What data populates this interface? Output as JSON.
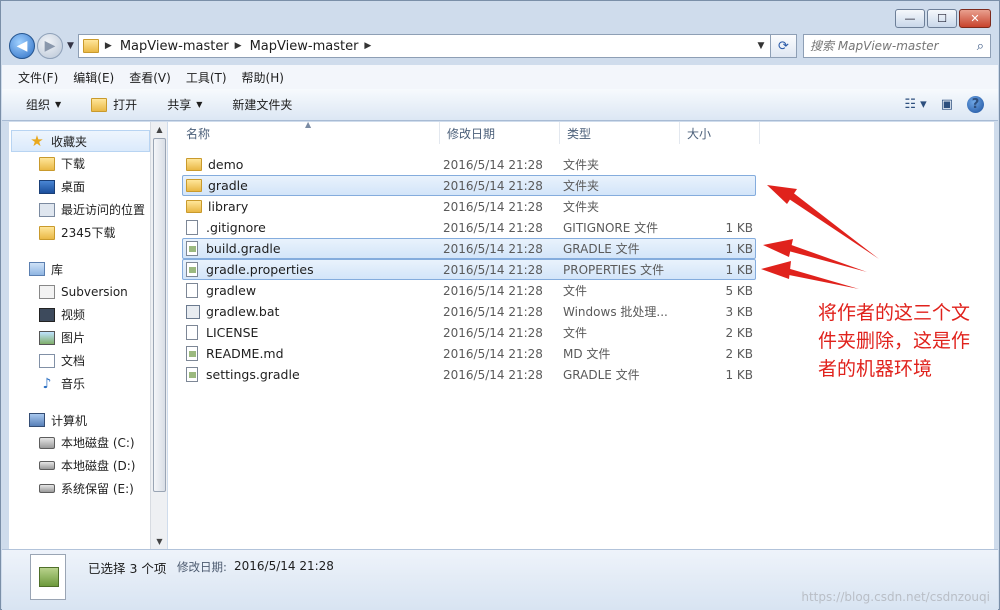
{
  "window": {
    "caption": {
      "minimize": "—",
      "maximize": "☐",
      "close": "✕"
    }
  },
  "address": {
    "crumbs": [
      "MapView-master",
      "MapView-master"
    ],
    "search_placeholder": "搜索 MapView-master"
  },
  "menu": [
    "文件(F)",
    "编辑(E)",
    "查看(V)",
    "工具(T)",
    "帮助(H)"
  ],
  "commands": {
    "organize": "组织",
    "open": "打开",
    "share": "共享",
    "new_folder": "新建文件夹"
  },
  "nav": {
    "favorites": {
      "label": "收藏夹",
      "items": [
        "下载",
        "桌面",
        "最近访问的位置",
        "2345下载"
      ]
    },
    "libraries": {
      "label": "库",
      "items": [
        "Subversion",
        "视频",
        "图片",
        "文档",
        "音乐"
      ]
    },
    "computer": {
      "label": "计算机",
      "items": [
        "本地磁盘 (C:)",
        "本地磁盘 (D:)",
        "系统保留 (E:)"
      ]
    }
  },
  "columns": {
    "name": "名称",
    "date": "修改日期",
    "type": "类型",
    "size": "大小"
  },
  "files": [
    {
      "name": "demo",
      "date": "2016/5/14 21:28",
      "type": "文件夹",
      "size": "",
      "icon": "folder-icon",
      "selected": false
    },
    {
      "name": "gradle",
      "date": "2016/5/14 21:28",
      "type": "文件夹",
      "size": "",
      "icon": "folder-icon",
      "selected": true
    },
    {
      "name": "library",
      "date": "2016/5/14 21:28",
      "type": "文件夹",
      "size": "",
      "icon": "folder-icon",
      "selected": false
    },
    {
      "name": ".gitignore",
      "date": "2016/5/14 21:28",
      "type": "GITIGNORE 文件",
      "size": "1 KB",
      "icon": "file-icon",
      "selected": false
    },
    {
      "name": "build.gradle",
      "date": "2016/5/14 21:28",
      "type": "GRADLE 文件",
      "size": "1 KB",
      "icon": "gradle-file-icon",
      "selected": true
    },
    {
      "name": "gradle.properties",
      "date": "2016/5/14 21:28",
      "type": "PROPERTIES 文件",
      "size": "1 KB",
      "icon": "gradle-file-icon",
      "selected": true
    },
    {
      "name": "gradlew",
      "date": "2016/5/14 21:28",
      "type": "文件",
      "size": "5 KB",
      "icon": "file-icon",
      "selected": false
    },
    {
      "name": "gradlew.bat",
      "date": "2016/5/14 21:28",
      "type": "Windows 批处理...",
      "size": "3 KB",
      "icon": "batch-file-icon",
      "selected": false
    },
    {
      "name": "LICENSE",
      "date": "2016/5/14 21:28",
      "type": "文件",
      "size": "2 KB",
      "icon": "file-icon",
      "selected": false
    },
    {
      "name": "README.md",
      "date": "2016/5/14 21:28",
      "type": "MD 文件",
      "size": "2 KB",
      "icon": "gradle-file-icon",
      "selected": false
    },
    {
      "name": "settings.gradle",
      "date": "2016/5/14 21:28",
      "type": "GRADLE 文件",
      "size": "1 KB",
      "icon": "gradle-file-icon",
      "selected": false
    }
  ],
  "annotation": "将作者的这三个文件夹删除，这是作者的机器环境",
  "details": {
    "selection": "已选择 3 个项",
    "modified_label": "修改日期:",
    "modified_value": "2016/5/14 21:28"
  },
  "watermark": "https://blog.csdn.net/csdnzouqi",
  "colors": {
    "annotation_red": "#e0221c",
    "selection_border": "#84acdd"
  }
}
